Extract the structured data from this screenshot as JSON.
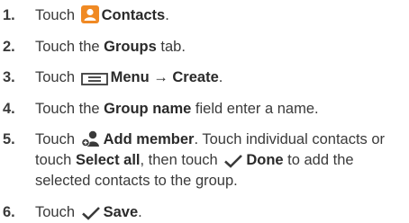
{
  "steps": [
    {
      "number": "1.",
      "parts": [
        "Touch",
        "Contacts",
        "."
      ]
    },
    {
      "number": "2.",
      "parts": [
        "Touch the ",
        "Groups",
        " tab."
      ]
    },
    {
      "number": "3.",
      "parts": [
        "Touch",
        "Menu",
        " → ",
        "Create",
        "."
      ]
    },
    {
      "number": "4.",
      "parts": [
        "Touch the ",
        "Group name",
        " field enter a name."
      ]
    },
    {
      "number": "5.",
      "lines": [
        {
          "parts": [
            "Touch",
            "Add member",
            ". Touch individual contacts or"
          ]
        },
        {
          "parts": [
            "touch ",
            "Select all",
            ", then touch",
            "Done",
            " to add the"
          ]
        },
        {
          "parts": [
            "selected contacts to the group."
          ]
        }
      ]
    },
    {
      "number": "6.",
      "parts": [
        "Touch",
        "Save",
        "."
      ]
    }
  ],
  "icons": {
    "contacts": "contacts-app-icon",
    "menu": "menu-icon",
    "add_member": "add-member-icon",
    "done": "checkmark-icon",
    "save": "checkmark-icon"
  },
  "colors": {
    "contacts_icon_bg": "#f08a24",
    "text": "#3a3a3a"
  }
}
